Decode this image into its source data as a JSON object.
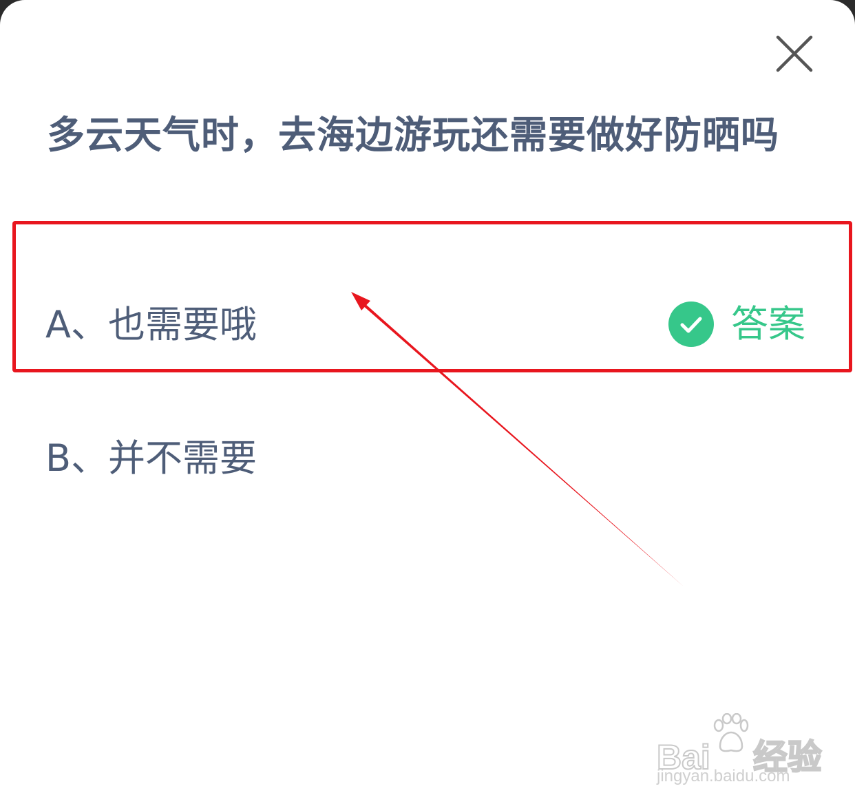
{
  "question": {
    "text": "多云天气时，去海边游玩还需要做好防晒吗"
  },
  "options": [
    {
      "label": "A、也需要哦",
      "is_answer": true
    },
    {
      "label": "B、并不需要",
      "is_answer": false
    }
  ],
  "answer_badge": {
    "label": "答案",
    "icon": "check-circle-icon",
    "color": "#36c78a"
  },
  "close_icon": "close-icon",
  "annotation": {
    "box_color": "#e8161e",
    "arrow_color": "#e8161e"
  },
  "watermark": {
    "brand_prefix": "Bai",
    "brand_suffix": "经验",
    "url": "jingyan.baidu.com"
  },
  "colors": {
    "text": "#4e5d78",
    "background": "#ffffff"
  }
}
